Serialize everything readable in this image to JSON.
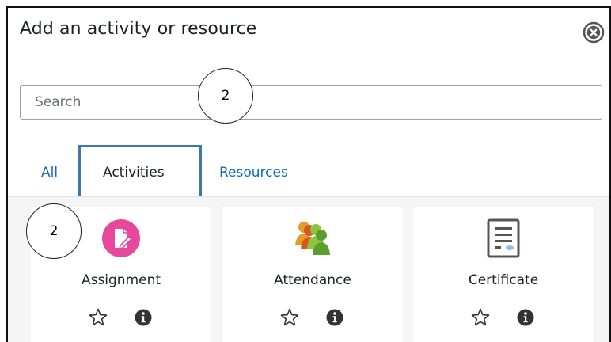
{
  "dialog": {
    "title": "Add an activity or resource",
    "close_icon": "close-circle-icon"
  },
  "search": {
    "placeholder": "Search",
    "value": ""
  },
  "callouts": [
    "2",
    "2"
  ],
  "tabs": [
    {
      "label": "All",
      "active": false
    },
    {
      "label": "Activities",
      "active": true
    },
    {
      "label": "Resources",
      "active": false
    }
  ],
  "cards": [
    {
      "label": "Assignment",
      "icon": "assignment-icon",
      "icon_color": "#e8489b"
    },
    {
      "label": "Attendance",
      "icon": "attendance-icon",
      "icon_color": "#6aab2e"
    },
    {
      "label": "Certificate",
      "icon": "certificate-icon",
      "icon_color": "#555555"
    }
  ],
  "card_actions": {
    "star_icon": "star-outline-icon",
    "info_icon": "info-circle-icon"
  },
  "colors": {
    "link": "#0f6cbf",
    "tab_highlight": "#3d78a8",
    "text": "#1d2125"
  }
}
